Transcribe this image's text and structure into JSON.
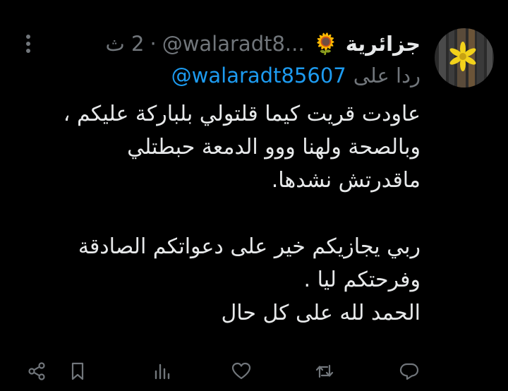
{
  "tweet": {
    "author_name": "جزائرية",
    "badge_emoji": "🌻",
    "handle": "@walaradt8...",
    "separator": "·",
    "time": "2 ث",
    "replying_prefix": "ردا على",
    "replying_handle": "@walaradt85607",
    "body_lines": [
      "عاودت قريت كيما قلتولي بلباركة عليكم ،",
      "وبالصحة ولهنا ووو الدمعة حبطتلي",
      "ماقدرتش نشدها.",
      "ربي يجازيكم خير على دعواتكم الصادقة",
      "وفرحتكم ليا .",
      "الحمد لله على كل حال"
    ]
  },
  "icons": {
    "avatar": "sunflower-avatar",
    "more": "more-dots-icon",
    "reply": "reply-icon",
    "retweet": "retweet-icon",
    "like": "like-icon",
    "views": "views-icon",
    "bookmark": "bookmark-icon",
    "share": "share-icon"
  },
  "colors": {
    "background": "#000000",
    "text": "#e7e9ea",
    "muted": "#71767b",
    "link": "#1d9bf0"
  }
}
